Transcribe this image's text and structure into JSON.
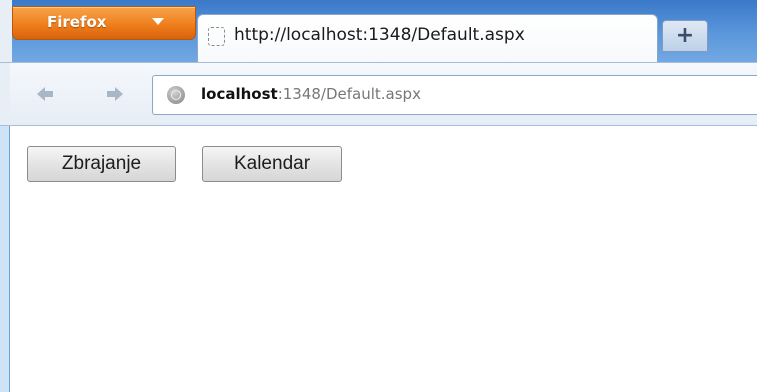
{
  "browser": {
    "menu_button_label": "Firefox",
    "tab_title": "http://localhost:1348/Default.aspx",
    "new_tab_label": "+",
    "back_glyph": "🡐",
    "forward_glyph": "🡒",
    "url_host": "localhost",
    "url_rest": ":1348/Default.aspx",
    "accent_color": "#ef7f1d"
  },
  "page": {
    "buttons": [
      {
        "label": "Zbrajanje"
      },
      {
        "label": "Kalendar"
      }
    ]
  },
  "icons": {
    "menu_caret": "chevron-down-icon",
    "favicon": "blank-page-icon",
    "site_identity": "globe-icon"
  }
}
